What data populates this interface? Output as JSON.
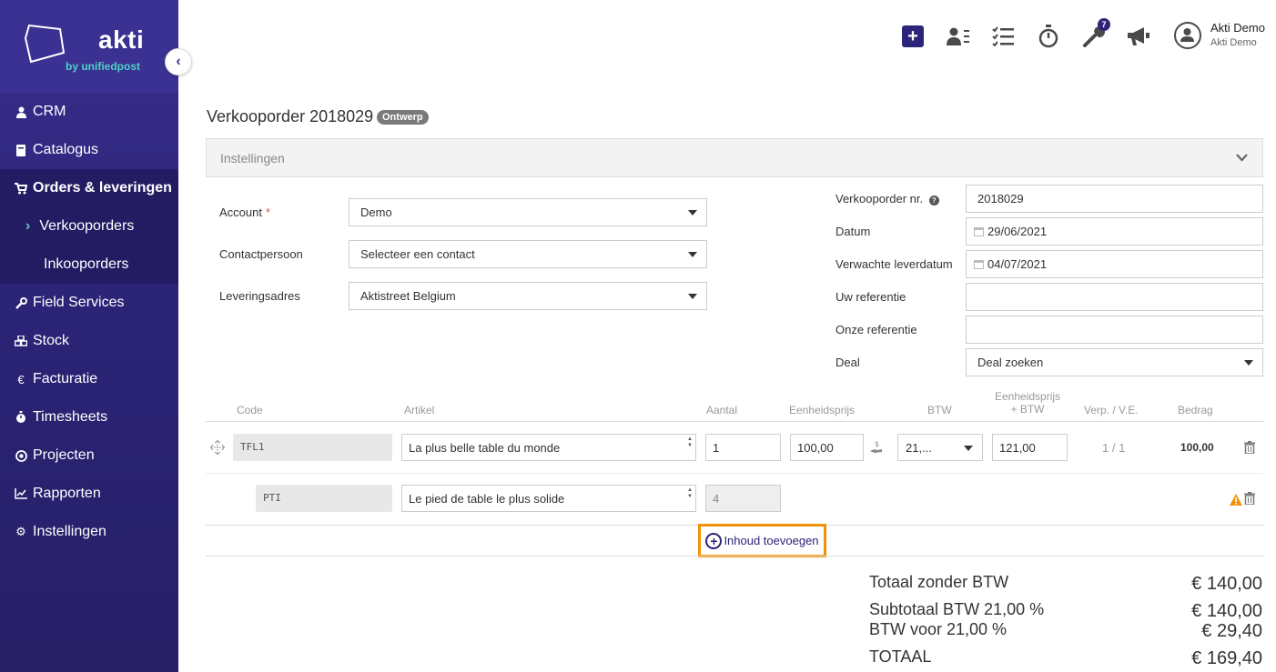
{
  "app": {
    "logo_text": "akti",
    "logo_sub": "by unifiedpost"
  },
  "sidebar": {
    "items": [
      {
        "label": "CRM",
        "icon": "user-icon"
      },
      {
        "label": "Catalogus",
        "icon": "book-icon"
      },
      {
        "label": "Orders & leveringen",
        "icon": "cart-icon",
        "active": true
      },
      {
        "label": "Verkooporders",
        "icon": "chevron-right-icon",
        "sub": true,
        "current": true
      },
      {
        "label": "Inkooporders",
        "sub": true
      },
      {
        "label": "Field Services",
        "icon": "wrench-icon"
      },
      {
        "label": "Stock",
        "icon": "cubes-icon"
      },
      {
        "label": "Facturatie",
        "icon": "euro-icon"
      },
      {
        "label": "Timesheets",
        "icon": "stopwatch-icon"
      },
      {
        "label": "Projecten",
        "icon": "target-icon"
      },
      {
        "label": "Rapporten",
        "icon": "chart-icon"
      },
      {
        "label": "Instellingen",
        "icon": "gear-icon"
      }
    ]
  },
  "topbar": {
    "notifications_badge": "7",
    "user_name": "Akti Demo",
    "user_company": "Akti Demo"
  },
  "page": {
    "title": "Verkooporder 2018029",
    "status": "Ontwerp",
    "settings_panel": "Instellingen"
  },
  "form_left": {
    "account_label": "Account",
    "account_required": "*",
    "account_value": "Demo",
    "contact_label": "Contactpersoon",
    "contact_value": "Selecteer een contact",
    "address_label": "Leveringsadres",
    "address_value": "Aktistreet Belgium"
  },
  "form_right": {
    "order_nr_label": "Verkooporder nr.",
    "order_nr_value": "2018029",
    "date_label": "Datum",
    "date_value": "29/06/2021",
    "delivery_label": "Verwachte leverdatum",
    "delivery_value": "04/07/2021",
    "your_ref_label": "Uw referentie",
    "your_ref_value": "",
    "our_ref_label": "Onze referentie",
    "our_ref_value": "",
    "deal_label": "Deal",
    "deal_value": "Deal zoeken"
  },
  "table": {
    "headers": {
      "code": "Code",
      "article": "Artikel",
      "qty": "Aantal",
      "unit_price": "Eenheidsprijs",
      "vat": "BTW",
      "unit_price_vat_1": "Eenheidsprijs",
      "unit_price_vat_2": "+ BTW",
      "pack": "Verp. / V.E.",
      "amount": "Bedrag"
    },
    "rows": [
      {
        "code": "TFL1",
        "article": "La plus belle table du monde",
        "qty": "1",
        "unit_price": "100,00",
        "vat": "21,...",
        "unit_price_vat": "121,00",
        "pack": "1 / 1",
        "amount": "100,00"
      },
      {
        "code": "PTI",
        "article": "Le pied de table le plus solide",
        "qty": "4"
      }
    ],
    "add_content": "Inhoud toevoegen"
  },
  "totals": {
    "excl_vat_label": "Totaal zonder BTW",
    "excl_vat_value": "€ 140,00",
    "subtotal_label": "Subtotaal  BTW 21,00 %",
    "subtotal_value": "€ 140,00",
    "vat_label": "BTW voor 21,00 %",
    "vat_value": "€ 29,40",
    "total_label": "TOTAAL",
    "total_value": "€ 169,40"
  }
}
